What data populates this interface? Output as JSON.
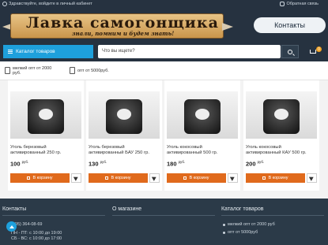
{
  "topbar": {
    "login_text": "Здравствуйте, войдите в личный кабинет",
    "callback_text": "Обратная связь"
  },
  "header": {
    "logo_title": "Лавка самогонщика",
    "logo_subtitle": "знали, помним и будем знать!",
    "contacts_label": "Контакты"
  },
  "nav": {
    "catalog_label": "Каталог товаров",
    "search_placeholder": "Что вы ищете?",
    "cart_count": "0"
  },
  "filters": [
    {
      "label_line1": "мелкий опт от 2000",
      "label_line2": "руб."
    },
    {
      "label_line1": "опт от 5000руб.",
      "label_line2": ""
    }
  ],
  "products": [
    {
      "name": "Уголь березовый активированный 250 гр.",
      "price": "100",
      "currency": "руб.",
      "buy_label": "В корзину"
    },
    {
      "name": "Уголь березовый активированный БАУ 250 гр.",
      "price": "130",
      "currency": "руб.",
      "buy_label": "В корзину"
    },
    {
      "name": "Уголь кокосовый активированный 500 гр.",
      "price": "180",
      "currency": "руб.",
      "buy_label": "В корзину"
    },
    {
      "name": "Уголь кокосовый активированный КАУ 500 гр.",
      "price": "200",
      "currency": "руб.",
      "buy_label": "В корзину"
    }
  ],
  "footer": {
    "contacts_title": "Контакты",
    "phone": "(495) 364-08-69",
    "hours1": "ПН - ПТ: с 10:00 до 19:00",
    "hours2": "СБ - ВС: с 10:00 до 17:00",
    "about_title": "О магазине",
    "catalog_title": "Каталог товаров",
    "catalog_items": [
      "мелкий опт от 2000 руб",
      "опт от 5000руб"
    ]
  },
  "colors": {
    "dark_bg": "#263240",
    "accent_blue": "#1ea0dc",
    "buy_orange": "#e06a1c"
  }
}
